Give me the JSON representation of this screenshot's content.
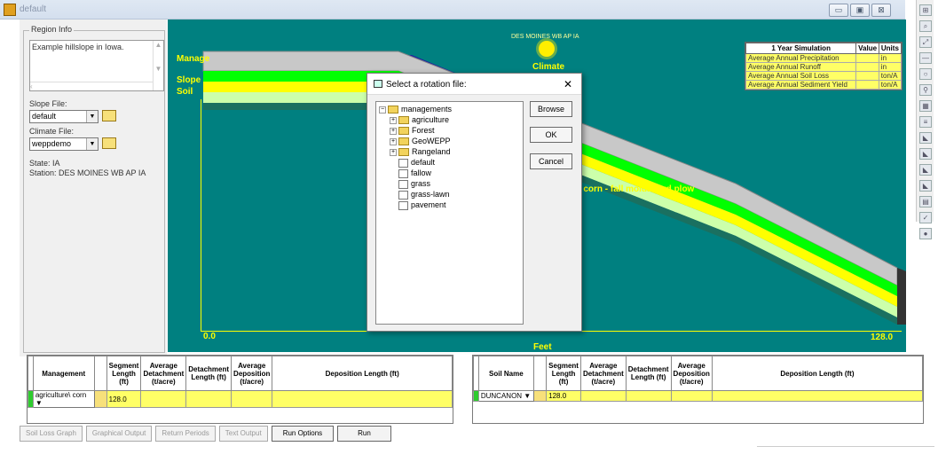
{
  "window": {
    "title": "default",
    "btn_min": "▭",
    "btn_max": "▣",
    "btn_close": "⊠"
  },
  "toolbar_icons": [
    "⊞",
    "⌕",
    "⤢",
    "—",
    "○",
    "⚲",
    "▦",
    "≡",
    "◣",
    "◣",
    "◣",
    "◣",
    "▤",
    "✓",
    "●"
  ],
  "region": {
    "legend": "Region Info",
    "description": "Example hillslope in Iowa.",
    "slope_label": "Slope File:",
    "slope_value": "default",
    "climate_label": "Climate File:",
    "climate_value": "weppdemo",
    "state": "State: IA",
    "station": "Station: DES MOINES WB AP IA"
  },
  "plot": {
    "station": "DES MOINES WB AP IA",
    "climate": "Climate",
    "management": "Manage",
    "slope": "Slope",
    "soil": "Soil",
    "rotation_label": "s corn - fall moldboard plow",
    "x_start": "0.0",
    "x_end": "128.0",
    "x_axis": "Feet"
  },
  "simulation": {
    "headers": [
      "1 Year Simulation",
      "Value",
      "Units"
    ],
    "rows": [
      {
        "name": "Average Annual Precipitation",
        "value": "",
        "unit": "in"
      },
      {
        "name": "Average Annual Runoff",
        "value": "",
        "unit": "in"
      },
      {
        "name": "Average Annual Soil Loss",
        "value": "",
        "unit": "ton/A"
      },
      {
        "name": "Average Annual Sediment Yield",
        "value": "",
        "unit": "ton/A"
      }
    ]
  },
  "dialog": {
    "title": "Select a rotation file:",
    "close": "✕",
    "browse": "Browse",
    "ok": "OK",
    "cancel": "Cancel",
    "root": "managements",
    "folders": [
      "agriculture",
      "Forest",
      "GeoWEPP",
      "Rangeland"
    ],
    "files": [
      "default",
      "fallow",
      "grass",
      "grass-lawn",
      "pavement"
    ]
  },
  "mgmt_grid": {
    "headers": [
      "Management",
      "Segment Length (ft)",
      "Average Detachment (t/acre)",
      "Detachment Length (ft)",
      "Average Deposition (t/acre)",
      "Deposition Length (ft)"
    ],
    "row": {
      "name": "agriculture\\ corn",
      "length": "128.0"
    }
  },
  "soil_grid": {
    "headers": [
      "Soil Name",
      "Segment Length (ft)",
      "Average Detachment (t/acre)",
      "Detachment Length (ft)",
      "Average Deposition (t/acre)",
      "Deposition Length (ft)"
    ],
    "row": {
      "name": "DUNCANON",
      "length": "128.0"
    }
  },
  "buttons": {
    "soil_loss_graph": "Soil Loss Graph",
    "graphical_output": "Graphical Output",
    "return_periods": "Return Periods",
    "text_output": "Text Output",
    "run_options": "Run Options",
    "run": "Run"
  },
  "colors": {
    "plot_bg": "#008080",
    "accent_yellow": "#ffff00",
    "grid_yellow": "#ffff66",
    "soil_green": "#00ff00"
  }
}
